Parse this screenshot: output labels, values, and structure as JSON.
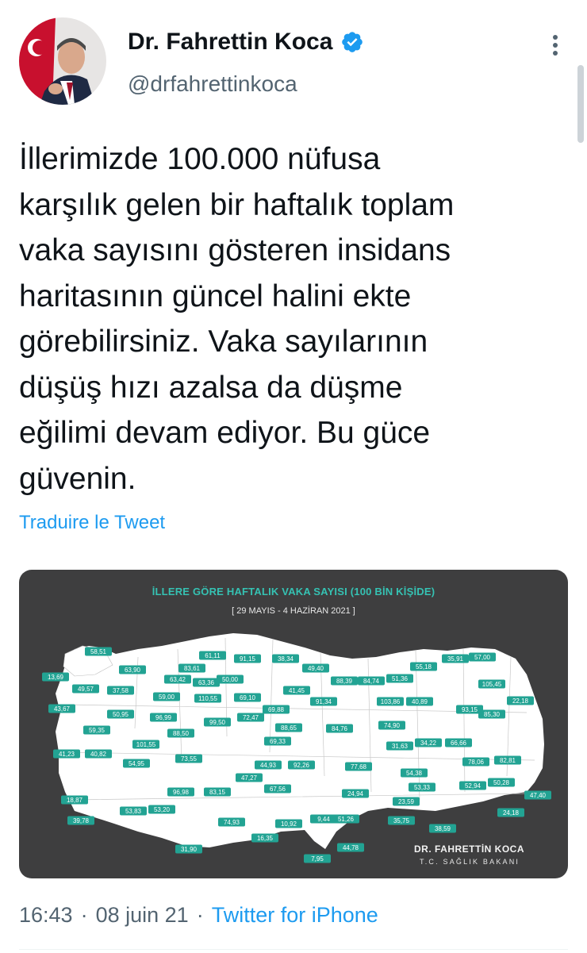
{
  "author": {
    "name": "Dr. Fahrettin Koca",
    "handle": "@drfahrettinkoca",
    "verified": true
  },
  "tweet": {
    "text": "İllerimizde 100.000 nüfusa\nkarşılık gelen bir haftalık toplam\nvaka sayısını gösteren insidans\nharitasının güncel halini ekte\ngörebilirsiniz. Vaka sayılarının\ndüşüş hızı azalsa da düşme\neğilimi devam ediyor. Bu güce\ngüvenin.",
    "translate_label": "Traduire le Tweet"
  },
  "media": {
    "title": "İLLERE GÖRE HAFTALIK VAKA SAYISI (100 BİN KİŞİDE)",
    "dates": "[ 29 MAYIS - 4 HAZİRAN 2021 ]",
    "signature": "DR. FAHRETTİN KOCA",
    "ministry": "T.C. SAĞLIK BAKANI",
    "values": [
      "58,51",
      "61,11",
      "91,15",
      "38,34",
      "49,40",
      "57,00",
      "35,91",
      "55,18",
      "63,90",
      "83,61",
      "50,00",
      "63,42",
      "63,36",
      "13,69",
      "49,57",
      "37,58",
      "59,00",
      "110,55",
      "69,10",
      "41,45",
      "88,39",
      "84,74",
      "51,36",
      "105,45",
      "22,18",
      "43,67",
      "50,95",
      "96,99",
      "72,47",
      "69,88",
      "91,34",
      "103,86",
      "40,89",
      "93,15",
      "85,30",
      "59,35",
      "88,50",
      "99,50",
      "88,65",
      "84,76",
      "74,90",
      "41,23",
      "40,82",
      "101,55",
      "69,33",
      "31,63",
      "34,22",
      "66,66",
      "54,95",
      "73,55",
      "44,93",
      "92,26",
      "77,68",
      "54,38",
      "78,06",
      "82,81",
      "47,27",
      "67,56",
      "53,33",
      "52,94",
      "50,28",
      "18,87",
      "96,98",
      "83,15",
      "24,94",
      "23,59",
      "47,40",
      "39,78",
      "53,83",
      "53,20",
      "10,92",
      "9,44",
      "51,26",
      "35,75",
      "24,18",
      "74,93",
      "38,59",
      "16,35",
      "44,78",
      "31,90",
      "7,95"
    ],
    "colors": {
      "background": "#3e3e3f",
      "land": "#ffffff",
      "badge": "#22a393",
      "accent": "#35c2b3"
    }
  },
  "meta": {
    "time": "16:43",
    "date": "08 juin 21",
    "source": "Twitter for iPhone"
  },
  "icons": [
    "avatar-image",
    "verified-badge-icon",
    "more-options-icon"
  ],
  "colors": {
    "link": "#1d9bf0",
    "secondary": "#536471",
    "text": "#0f1419"
  }
}
